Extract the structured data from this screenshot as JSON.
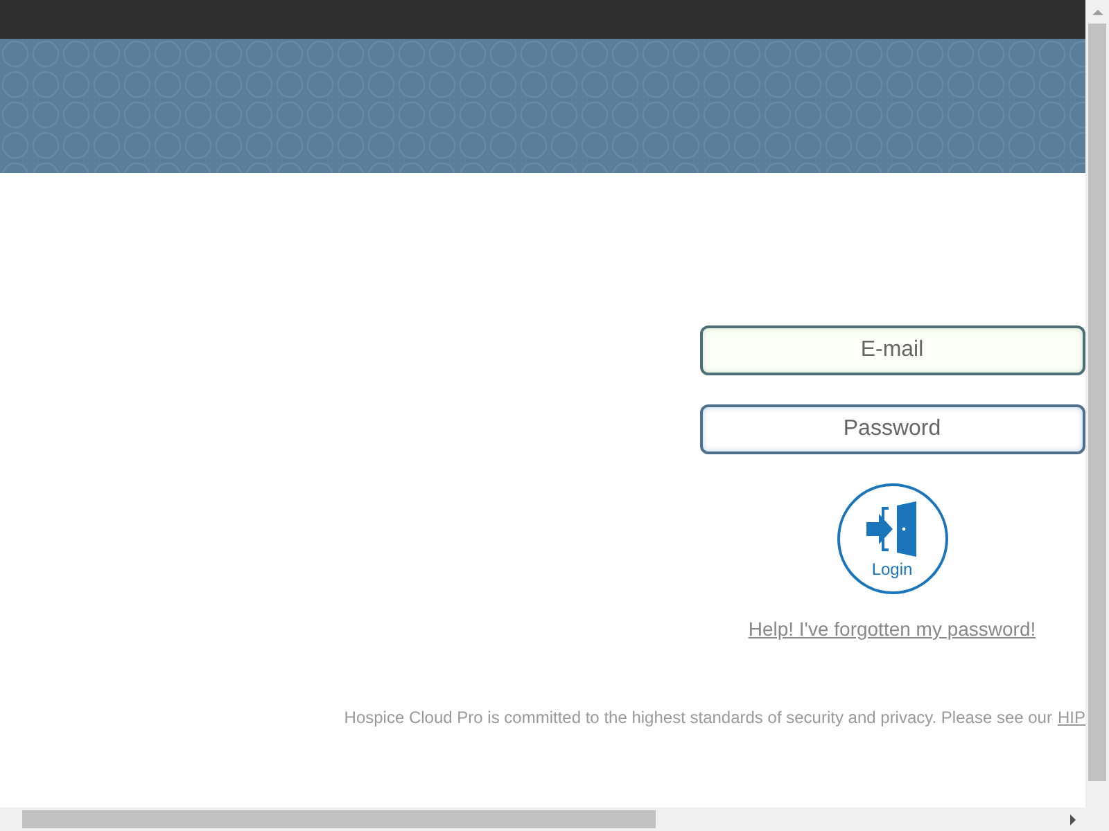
{
  "login_form": {
    "email": {
      "placeholder": "E-mail"
    },
    "password": {
      "placeholder": "Password"
    },
    "login_button": {
      "label": "Login"
    },
    "forgot_link": "Help! I've forgotten my password!"
  },
  "footer": {
    "text": "Hospice Cloud Pro is committed to the highest standards of security and privacy. Please see our",
    "link": "HIP"
  }
}
